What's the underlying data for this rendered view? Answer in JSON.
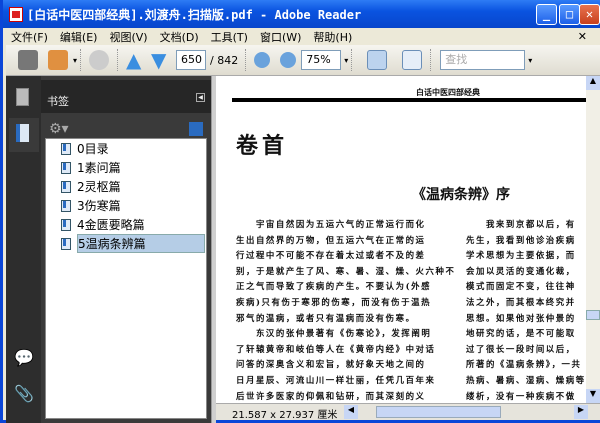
{
  "window": {
    "title": "[白话中医四部经典].刘渡舟.扫描版.pdf - Adobe Reader"
  },
  "menu": [
    "文件(F)",
    "编辑(E)",
    "视图(V)",
    "文档(D)",
    "工具(T)",
    "窗口(W)",
    "帮助(H)"
  ],
  "toolbar": {
    "page": "650",
    "page_total": "/ 842",
    "zoom": "75%",
    "search_placeholder": "查找"
  },
  "bookmarks": {
    "title": "书签",
    "items": [
      "0目录",
      "1素问篇",
      "2灵枢篇",
      "3伤寒篇",
      "4金匮要略篇",
      "5温病条辨篇"
    ],
    "selected": 5
  },
  "document": {
    "running_head": "白话中医四部经典",
    "chapter": "卷首",
    "section": "《温病条辨》序",
    "col1": [
      "　　宇宙自然因为五运六气的正常运行而化",
      "生出自然界的万物，但五运六气在正常的运",
      "行过程中不可能不存在着太过或者不及的差",
      "别，于是就产生了风、寒、暑、湿、燥、火六种不",
      "正之气而导致了疾病的产生。不要认为(外感",
      "疾病)只有伤于寒邪的伤寒，而没有伤于温热",
      "邪气的温病，或者只有温病而没有伤寒。",
      "　　东汉的张仲景著有《伤寒论》，发挥阐明",
      "了轩辕黄帝和岐伯等人在《黄帝内经》中对话",
      "问答的深奥含义和宏旨，就好象天地之间的",
      "日月星辰、河流山川一样壮丽，任凭几百年来",
      "后世许多医家的仰佩和钻研，而其深刻的义"
    ],
    "col2": [
      "　　我来到京都以后，有",
      "先生，我看到他诊治疾病",
      "学术思想为主要依据，而",
      "会加以灵活的变通化裁，",
      "模式而固定不变，往往神",
      "法之外，而其根本终究并",
      "思想。如果他对张仲景的",
      "地研究的话，是不可能取",
      "过了很长一段时间以后，",
      "所著的《温病条辨》，一共",
      "热病、暑病、湿病、燥病等",
      "缕析，没有一种疾病不做"
    ]
  },
  "status": {
    "page_size": "21.587 x 27.937 厘米"
  }
}
